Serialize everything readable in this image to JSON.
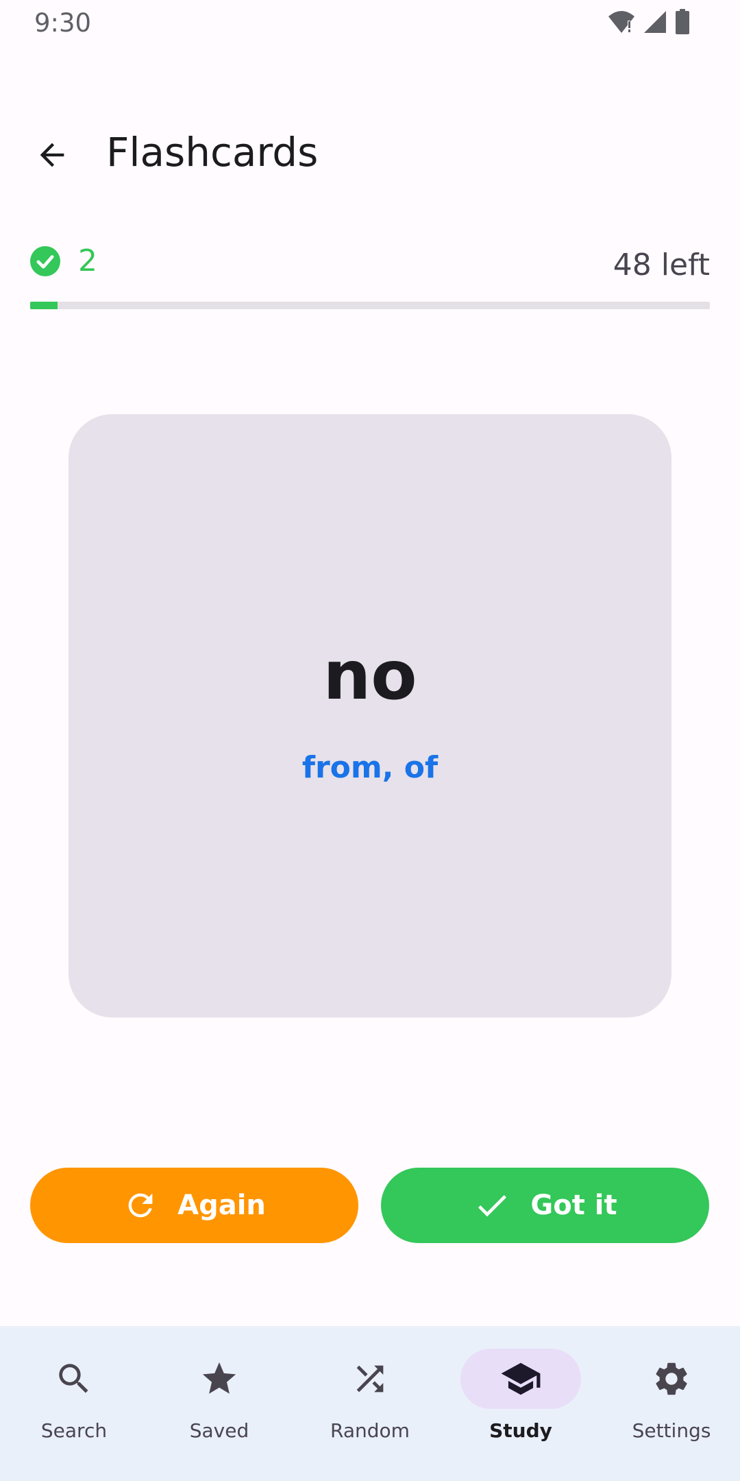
{
  "status_bar": {
    "time": "9:30",
    "icons": [
      "wifi-icon",
      "signal-icon",
      "battery-icon"
    ]
  },
  "app_bar": {
    "title": "Flashcards",
    "back_icon": "arrow-back-icon"
  },
  "progress": {
    "known": "2",
    "remaining": "48 left",
    "fraction": 0.04
  },
  "card": {
    "word": "no",
    "meaning": "from, of"
  },
  "actions": {
    "again_label": "Again",
    "gotit_label": "Got it"
  },
  "bottom_nav": {
    "items": [
      {
        "label": "Search",
        "icon": "search-icon"
      },
      {
        "label": "Saved",
        "icon": "star-icon"
      },
      {
        "label": "Random",
        "icon": "shuffle-icon"
      },
      {
        "label": "Study",
        "icon": "graduation-cap-icon",
        "active": true
      },
      {
        "label": "Settings",
        "icon": "gear-icon"
      }
    ]
  },
  "colors": {
    "success": "#34c759",
    "warning": "#ff9500",
    "accent_text": "#1a73e8",
    "card_bg": "#e6e1ea",
    "nav_bg": "#eaf0fa",
    "nav_active": "#e8def8"
  }
}
